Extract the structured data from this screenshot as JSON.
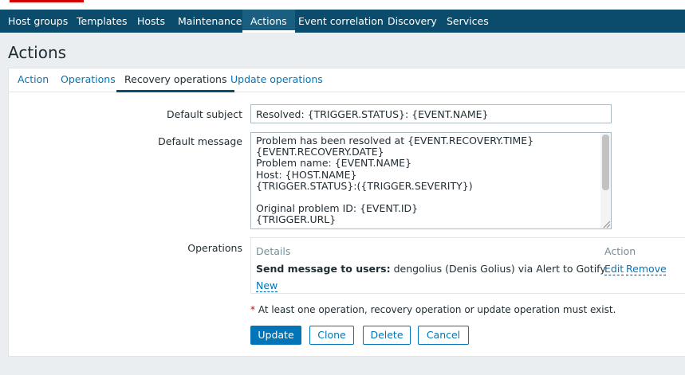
{
  "nav": {
    "items": [
      "Host groups",
      "Templates",
      "Hosts",
      "Maintenance",
      "Actions",
      "Event correlation",
      "Discovery",
      "Services"
    ],
    "active_index": 4
  },
  "page": {
    "title": "Actions"
  },
  "tabs": {
    "items": [
      "Action",
      "Operations",
      "Recovery operations",
      "Update operations"
    ],
    "active_index": 2
  },
  "form": {
    "subject_label": "Default subject",
    "subject_value": "Resolved: {TRIGGER.STATUS}: {EVENT.NAME}",
    "message_label": "Default message",
    "message_value": "Problem has been resolved at {EVENT.RECOVERY.TIME}\n{EVENT.RECOVERY.DATE}\nProblem name: {EVENT.NAME}\nHost: {HOST.NAME}\n{TRIGGER.STATUS}:({TRIGGER.SEVERITY})\n\nOriginal problem ID: {EVENT.ID}\n{TRIGGER.URL}",
    "operations_label": "Operations"
  },
  "operations": {
    "col_details": "Details",
    "col_action": "Action",
    "rows": [
      {
        "bold": "Send message to users:",
        "text": " dengolius (Denis Golius) via Alert to Gotify",
        "edit": "Edit",
        "remove": "Remove"
      }
    ],
    "new_label": "New"
  },
  "warning": {
    "star": "*",
    "text": " At least one operation, recovery operation or update operation must exist."
  },
  "buttons": {
    "update": "Update",
    "clone": "Clone",
    "delete": "Delete",
    "cancel": "Cancel"
  },
  "colors": {
    "nav_bg": "#0b4c6d",
    "link": "#0275b8",
    "primary": "#0275b8",
    "required_star": "#d40000"
  }
}
